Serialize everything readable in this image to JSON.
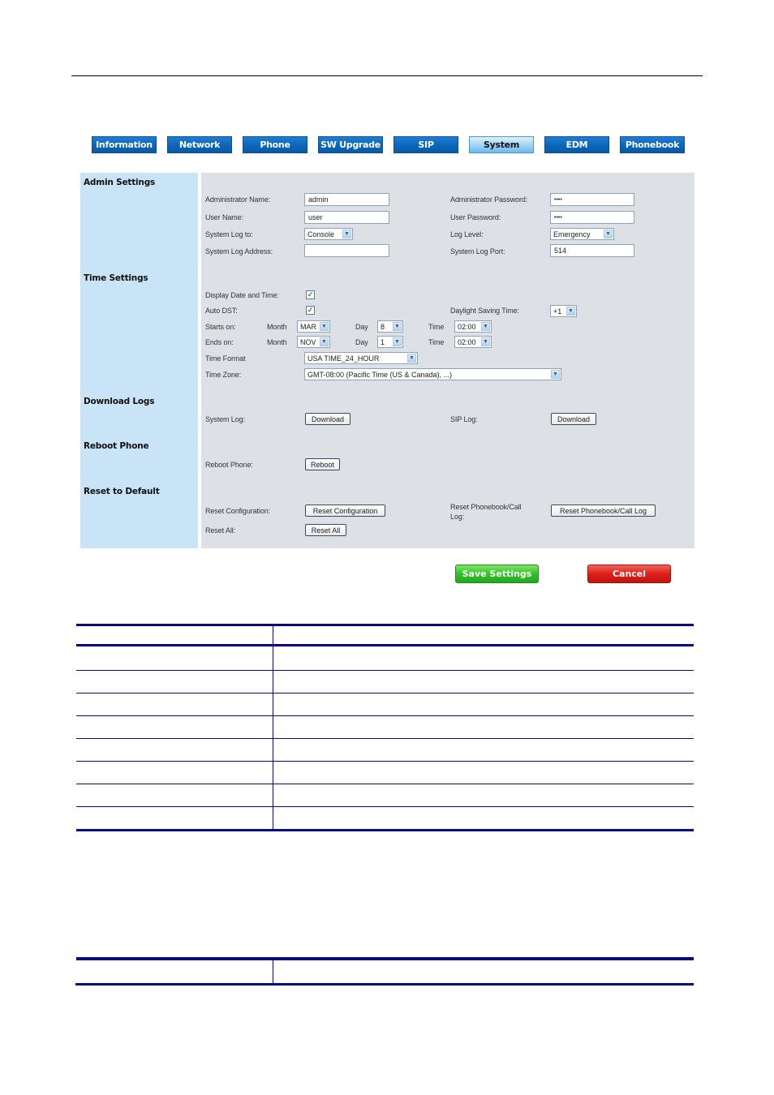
{
  "tabs": [
    {
      "label": "Information",
      "active": false
    },
    {
      "label": "Network",
      "active": false
    },
    {
      "label": "Phone",
      "active": false
    },
    {
      "label": "SW Upgrade",
      "active": false
    },
    {
      "label": "SIP",
      "active": false
    },
    {
      "label": "System",
      "active": true
    },
    {
      "label": "EDM",
      "active": false
    },
    {
      "label": "Phonebook",
      "active": false
    }
  ],
  "sections": {
    "admin": {
      "title": "Admin Settings",
      "admin_name_label": "Administrator Name:",
      "admin_name_value": "admin",
      "admin_password_label": "Administrator Password:",
      "admin_password_value": "••••",
      "user_name_label": "User Name:",
      "user_name_value": "user",
      "user_password_label": "User Password:",
      "user_password_value": "••••",
      "syslog_to_label": "System Log to:",
      "syslog_to_value": "Console",
      "log_level_label": "Log Level:",
      "log_level_value": "Emergency",
      "syslog_address_label": "System Log Address:",
      "syslog_address_value": "",
      "syslog_port_label": "System Log Port:",
      "syslog_port_value": "514"
    },
    "time": {
      "title": "Time Settings",
      "display_datetime_label": "Display Date and Time:",
      "display_datetime_checked": true,
      "auto_dst_label": "Auto DST:",
      "auto_dst_checked": true,
      "dst_label": "Daylight Saving Time:",
      "dst_value": "+1",
      "starts_on_label": "Starts on:",
      "ends_on_label": "Ends on:",
      "month_label": "Month",
      "day_label": "Day",
      "time_label": "Time",
      "start_month": "MAR",
      "start_day": "8",
      "start_time": "02:00",
      "end_month": "NOV",
      "end_day": "1",
      "end_time": "02:00",
      "time_format_label": "Time Format",
      "time_format_value": "USA TIME_24_HOUR",
      "time_zone_label": "Time Zone:",
      "time_zone_value": "GMT-08:00 (Pacific Time (US & Canada), ...)"
    },
    "download": {
      "title": "Download Logs",
      "system_log_label": "System Log:",
      "system_log_button": "Download",
      "sip_log_label": "SIP Log:",
      "sip_log_button": "Download"
    },
    "reboot": {
      "title": "Reboot Phone",
      "reboot_label": "Reboot Phone:",
      "reboot_button": "Reboot"
    },
    "reset": {
      "title": "Reset to Default",
      "reset_config_label": "Reset Configuration:",
      "reset_config_button": "Reset Configuration",
      "reset_phonebook_label": "Reset Phonebook/Call Log:",
      "reset_phonebook_button": "Reset Phonebook/Call Log",
      "reset_all_label": "Reset All:",
      "reset_all_button": "Reset All"
    }
  },
  "actions": {
    "save_label": "Save Settings",
    "cancel_label": "Cancel"
  },
  "colors": {
    "tab_blue": "#0b63b6",
    "tab_active": "#9fd2f6",
    "panel_left": "#c9e4f6",
    "panel_right": "#dde1e5",
    "save_green": "#34c22a",
    "cancel_red": "#dd1f16",
    "table_rule": "#0a0a7a"
  },
  "doc_table_1": {
    "header_rows": 1,
    "body_rows": 8
  },
  "doc_table_2": {
    "header_rows": 1,
    "body_rows": 0
  }
}
